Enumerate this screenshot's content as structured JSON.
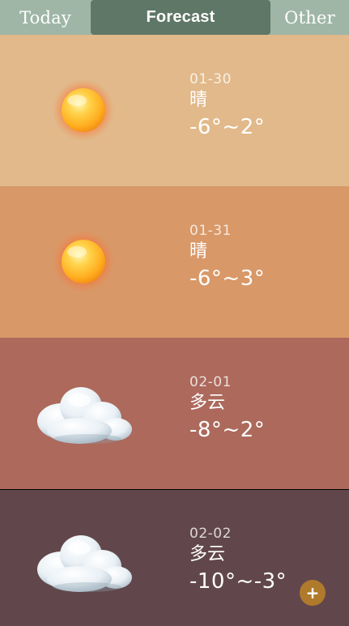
{
  "tabs": {
    "today": "Today",
    "forecast": "Forecast",
    "other": "Other",
    "active": "forecast"
  },
  "colors": {
    "tabbar_bg": "#9fb6a6",
    "tab_active_bg": "#5f7766"
  },
  "forecast": [
    {
      "date": "01-30",
      "condition": "晴",
      "temp": "-6°~2°",
      "icon": "sunny-icon",
      "bg": "#e1b98a"
    },
    {
      "date": "01-31",
      "condition": "晴",
      "temp": "-6°~3°",
      "icon": "sunny-icon",
      "bg": "#d89868"
    },
    {
      "date": "02-01",
      "condition": "多云",
      "temp": "-8°~2°",
      "icon": "cloudy-icon",
      "bg": "#ac695c"
    },
    {
      "date": "02-02",
      "condition": "多云",
      "temp": "-10°~-3°",
      "icon": "cloudy-icon",
      "bg": "#61474b"
    }
  ],
  "fab": {
    "label": "+"
  }
}
